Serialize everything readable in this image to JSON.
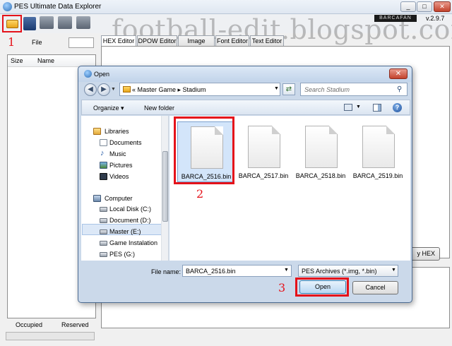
{
  "app": {
    "title": "PES Ultimate Data Explorer",
    "version": "v.2.9.7",
    "brand_logo": "BARCAFAN",
    "watermark": "football-edit.blogspot.com",
    "window_buttons": {
      "minimize": "_",
      "maximize": "□",
      "close": "✕"
    }
  },
  "annotations": {
    "step1": "1",
    "step2": "2",
    "step3": "3",
    "accent_color": "#e5121a"
  },
  "left_pane": {
    "file_label": "File",
    "columns": [
      "Size",
      "Name"
    ],
    "status": {
      "occupied": "Occupied",
      "reserved": "Reserved"
    }
  },
  "tabs": [
    "HEX Editor",
    "DPOW Editor",
    "Image Editor",
    "Font Editor",
    "Text Editor"
  ],
  "hex_button_label": "y HEX",
  "dialog": {
    "title": "Open",
    "close_glyph": "✕",
    "nav_back": "◀",
    "nav_forward": "▶",
    "address": "«  Master Game  ▸  Stadium",
    "search_placeholder": "Search Stadium",
    "toolbar": {
      "organize": "Organize ▾",
      "new_folder": "New folder",
      "help": "?"
    },
    "nav": {
      "libraries": "Libraries",
      "documents": "Documents",
      "music": "Music",
      "pictures": "Pictures",
      "videos": "Videos",
      "computer": "Computer",
      "local_disk": "Local Disk (C:)",
      "document_d": "Document (D:)",
      "master_e": "Master (E:)",
      "game_installation": "Game Instalation",
      "pes_g": "PES (G:)"
    },
    "files": [
      {
        "name": "BARCA_2516.bin",
        "selected": true
      },
      {
        "name": "BARCA_2517.bin",
        "selected": false
      },
      {
        "name": "BARCA_2518.bin",
        "selected": false
      },
      {
        "name": "BARCA_2519.bin",
        "selected": false
      }
    ],
    "file_name_label": "File name:",
    "file_name_value": "BARCA_2516.bin",
    "filter": "PES Archives (*.img, *.bin)",
    "open_label": "Open",
    "cancel_label": "Cancel"
  }
}
